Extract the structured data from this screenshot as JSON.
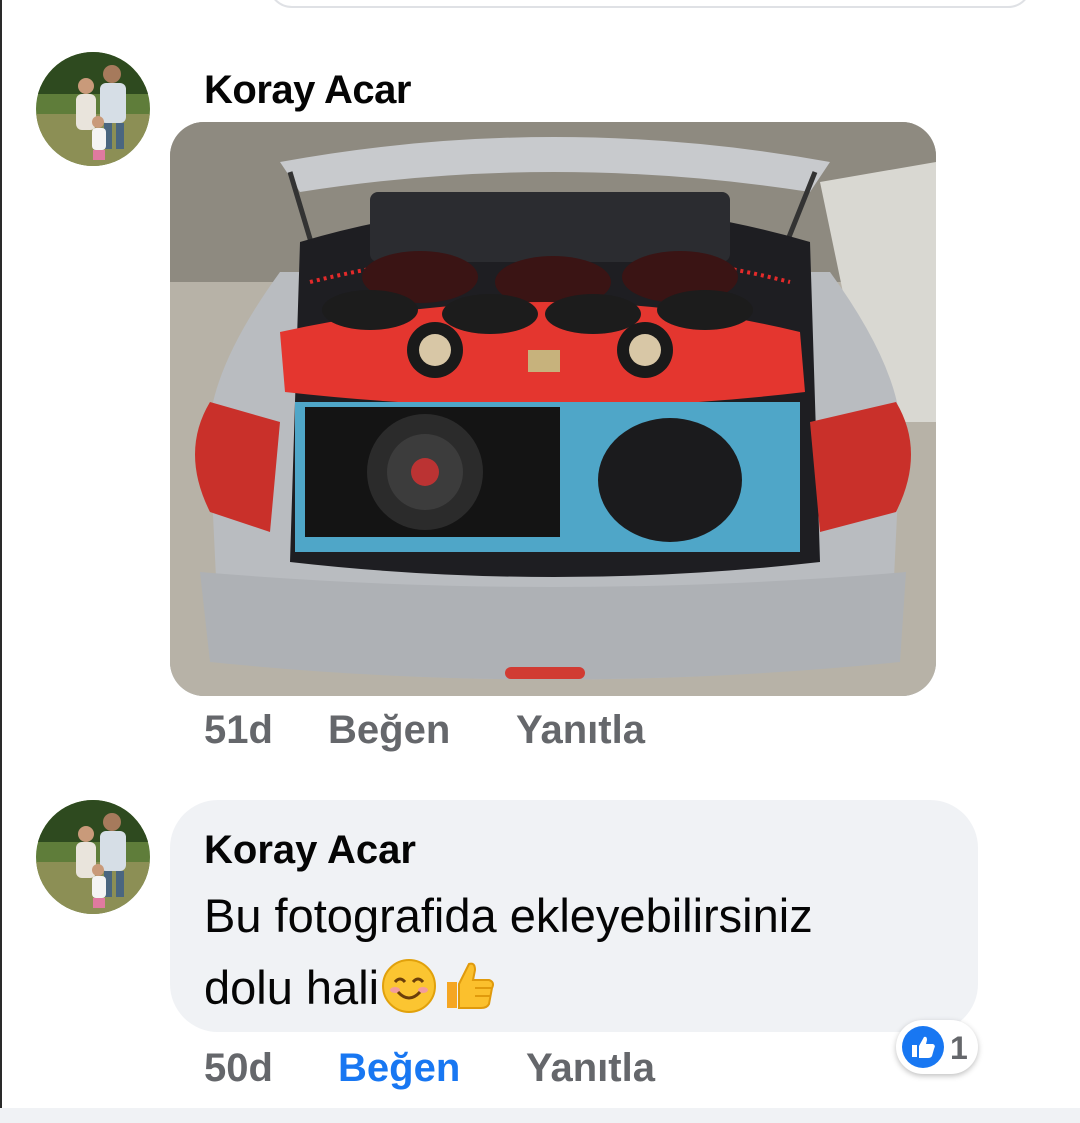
{
  "comments": [
    {
      "author": "Koray Acar",
      "timestamp": "51d",
      "like_label": "Beğen",
      "reply_label": "Yanıtla",
      "liked_by_user": false,
      "attachment": "photo"
    },
    {
      "author": "Koray Acar",
      "text_line1": "Bu fotografida ekleyebilirsiniz",
      "text_line2": "dolu hali",
      "emojis": [
        "smiling-face-icon",
        "thumbs-up-icon"
      ],
      "timestamp": "50d",
      "like_label": "Beğen",
      "reply_label": "Yanıtla",
      "liked_by_user": true,
      "reaction": {
        "icon": "like-reaction-icon",
        "count": "1"
      }
    }
  ],
  "colors": {
    "author_text": "#050505",
    "meta_text": "#65676b",
    "liked_blue": "#1877f2",
    "bubble_bg": "#f0f2f5"
  }
}
